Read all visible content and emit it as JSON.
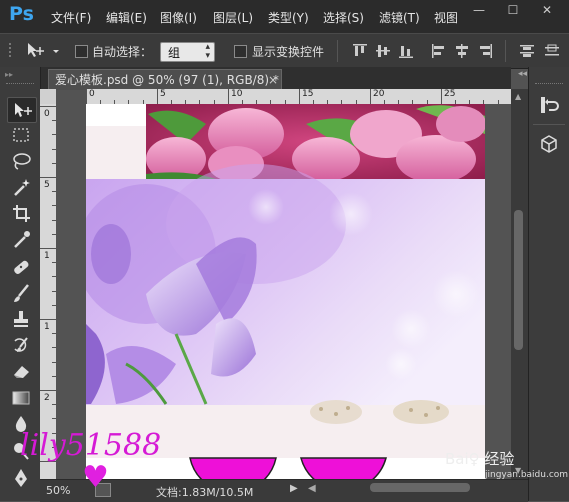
{
  "app": {
    "logo": "Ps"
  },
  "menu": [
    "文件(F)",
    "编辑(E)",
    "图像(I)",
    "图层(L)",
    "类型(Y)",
    "选择(S)",
    "滤镜(T)",
    "视图"
  ],
  "window_controls": {
    "minimize": "—",
    "restore": "☐",
    "close": "✕"
  },
  "options": {
    "auto_select_label": "自动选择：",
    "auto_select_value": "组",
    "show_transform_label": "显示变换控件"
  },
  "tab": {
    "title": "爱心模板.psd @ 50% (97 (1), RGB/8) *",
    "close": "×"
  },
  "ruler": {
    "h_labels": [
      "0",
      "5",
      "10",
      "15",
      "20",
      "25"
    ],
    "v_labels": [
      "0",
      "5",
      "1",
      "1",
      "2"
    ]
  },
  "status": {
    "zoom": "50%",
    "doc_info": "文档:1.83M/10.5M"
  },
  "watermark": {
    "text": "lily51588",
    "heart": "♥"
  },
  "baidu": {
    "text": "Bai♀ 经验",
    "sub": "jingyan.baidu.com"
  },
  "colors": {
    "menubar": "#2b2b2b",
    "accent": "#3ea6f0",
    "magenta": "#ee10d8"
  },
  "tools": [
    "move-tool",
    "marquee-tool",
    "lasso-tool",
    "magic-wand-tool",
    "crop-tool",
    "eyedropper-tool",
    "healing-brush-tool",
    "brush-tool",
    "stamp-tool",
    "history-brush-tool",
    "eraser-tool",
    "gradient-tool",
    "blur-tool",
    "dodge-tool",
    "pen-tool"
  ]
}
